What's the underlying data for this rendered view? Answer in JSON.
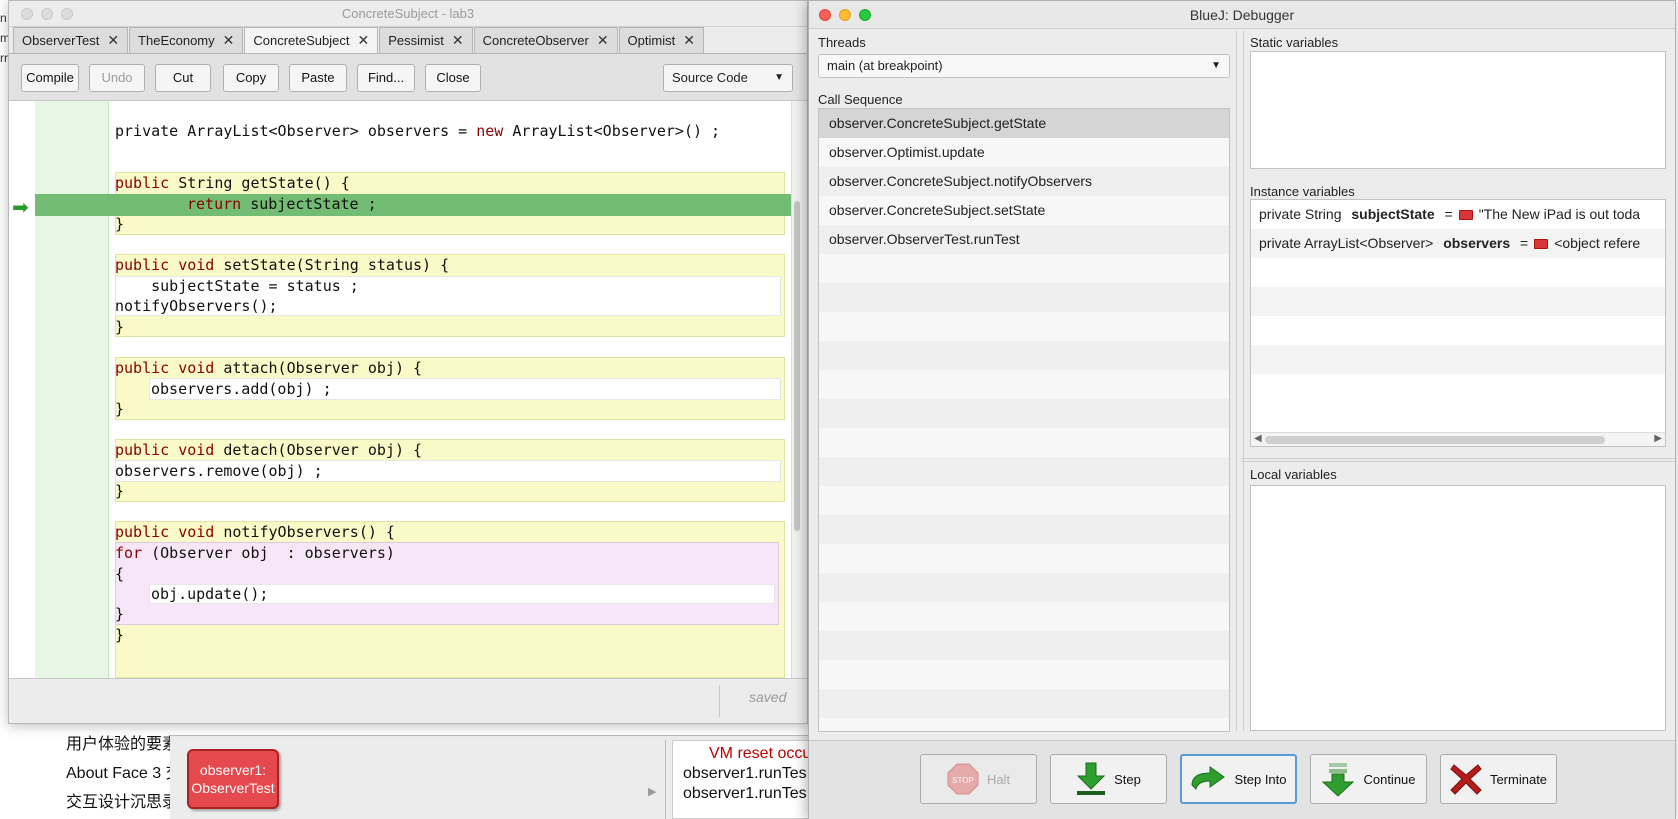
{
  "background": {
    "left_chars": [
      "n",
      "m",
      "rr"
    ],
    "list_items": [
      "用户体验的要素",
      "About Face 3 交",
      "交互设计沉思录"
    ],
    "object_bench": {
      "object_name": "observer1:",
      "object_class": "ObserverTest"
    },
    "terminal": {
      "line1": "VM reset occu",
      "line2": "observer1.runTes",
      "line3": "observer1.runTes"
    }
  },
  "editor": {
    "title": "ConcreteSubject - lab3",
    "tabs": [
      {
        "label": "ObserverTest"
      },
      {
        "label": "TheEconomy"
      },
      {
        "label": "ConcreteSubject"
      },
      {
        "label": "Pessimist"
      },
      {
        "label": "ConcreteObserver"
      },
      {
        "label": "Optimist"
      }
    ],
    "toolbar": {
      "compile": "Compile",
      "undo": "Undo",
      "cut": "Cut",
      "copy": "Copy",
      "paste": "Paste",
      "find": "Find...",
      "close": "Close",
      "view": "Source Code"
    },
    "code": {
      "l_decl_a": "private ArrayList<Observer> observers = ",
      "l_decl_kw": "new",
      "l_decl_b": " ArrayList<Observer>() ;",
      "l_getstate_kw": "public",
      "l_getstate": " String getState() {",
      "l_return_kw": "return",
      "l_return": " subjectState ;",
      "l_close1": "}",
      "l_setstate_kw": "public void",
      "l_setstate": " setState(String status) {",
      "l_assign": "    subjectState = status ;",
      "l_notify_call": "notifyObservers();",
      "l_close2": "}",
      "l_attach_kw": "public void",
      "l_attach": " attach(Observer obj) {",
      "l_add": "observers.add(obj) ;",
      "l_close3": "}",
      "l_detach_kw": "public void",
      "l_detach": " detach(Observer obj) {",
      "l_remove": "observers.remove(obj) ;",
      "l_close4": "}",
      "l_notify_kw": "public void",
      "l_notify": " notifyObservers() {",
      "l_for_kw": "for",
      "l_for": " (Observer obj  : observers)",
      "l_brace_open": "{",
      "l_update": "obj.update();",
      "l_brace_close": "}",
      "l_close5": "}"
    },
    "status": "saved"
  },
  "debugger": {
    "title": "BlueJ:  Debugger",
    "threads_label": "Threads",
    "thread_value": "main (at breakpoint)",
    "call_sequence_label": "Call Sequence",
    "call_sequence": [
      "observer.ConcreteSubject.getState",
      "observer.Optimist.update",
      "observer.ConcreteSubject.notifyObservers",
      "observer.ConcreteSubject.setState",
      "observer.ObserverTest.runTest"
    ],
    "static_label": "Static variables",
    "instance_label": "Instance variables",
    "instance_vars": [
      {
        "modifier": "private  String",
        "name": "subjectState",
        "eq": "=",
        "value": "\"The New iPad is out toda"
      },
      {
        "modifier": "private  ArrayList<Observer>",
        "name": "observers",
        "eq": "=",
        "value": "<object refere"
      }
    ],
    "local_label": "Local variables",
    "buttons": {
      "halt": "Halt",
      "step": "Step",
      "step_into": "Step Into",
      "continue": "Continue",
      "terminate": "Terminate"
    },
    "halt_icon_text": "STOP",
    "colors": {
      "execution_line": "#73bc73",
      "accent_focus": "#5a9ad8",
      "object_chip": "#e5484d"
    }
  }
}
